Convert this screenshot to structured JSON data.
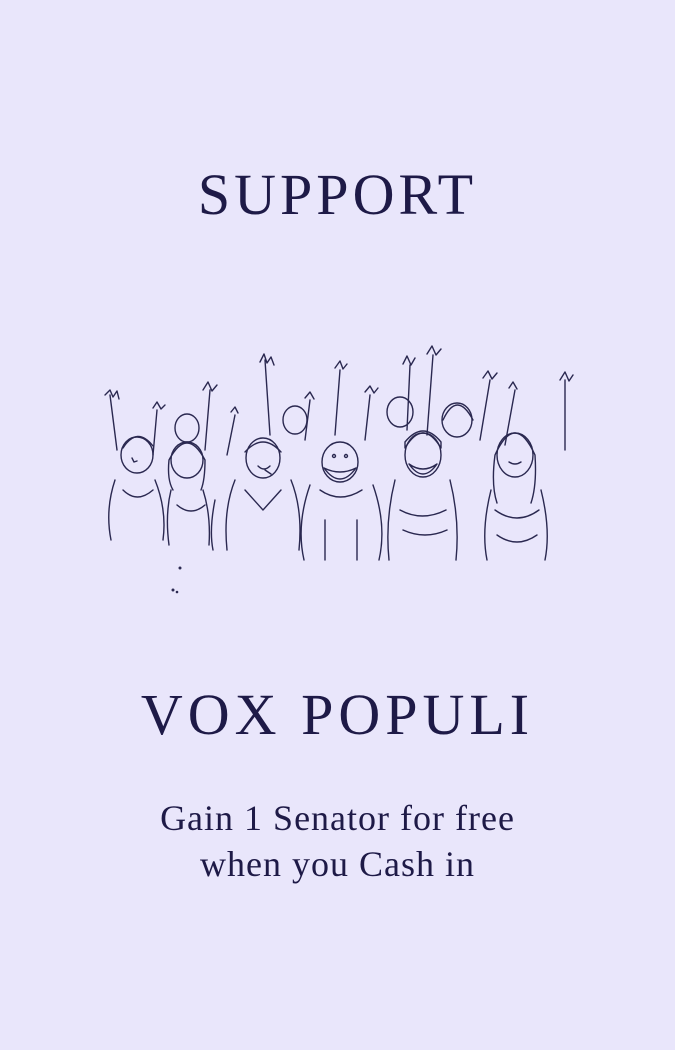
{
  "card": {
    "type_label": "SUPPORT",
    "title": "VOX POPULI",
    "effect_lines": [
      "Gain 1 Senator for free",
      "when you Cash in"
    ],
    "illustration_icon": "cheering-crowd-icon",
    "colors": {
      "background": "#e9e6fb",
      "ink": "#1e1a47",
      "sketch": "#2a2850"
    }
  }
}
